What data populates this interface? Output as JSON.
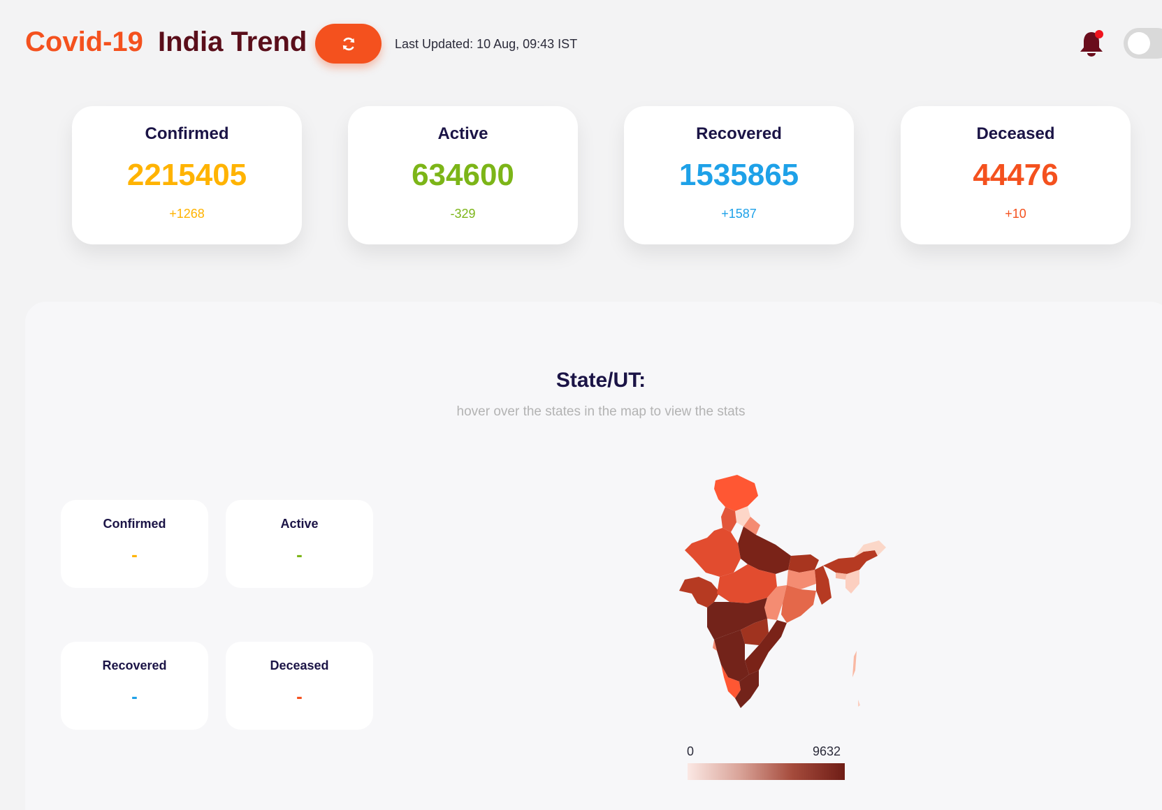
{
  "header": {
    "brand_primary": "Covid-19",
    "brand_secondary": "India Trend",
    "refresh_icon": "refresh-icon",
    "last_updated": "Last Updated: 10 Aug, 09:43 IST",
    "bell_icon": "bell-icon",
    "notification_dot": true,
    "theme_toggle": "off"
  },
  "stats": [
    {
      "label": "Confirmed",
      "value": "2215405",
      "delta": "+1268",
      "color": "#ffb300"
    },
    {
      "label": "Active",
      "value": "634600",
      "delta": "-329",
      "color": "#7cb518"
    },
    {
      "label": "Recovered",
      "value": "1535865",
      "delta": "+1587",
      "color": "#1ea1e8"
    },
    {
      "label": "Deceased",
      "value": "44476",
      "delta": "+10",
      "color": "#f4511e"
    }
  ],
  "state_panel": {
    "title": "State/UT:",
    "subtitle": "hover over the states in the map to view the stats",
    "cards": [
      {
        "label": "Confirmed",
        "value": "-",
        "color": "#ffb300"
      },
      {
        "label": "Active",
        "value": "-",
        "color": "#7cb518"
      },
      {
        "label": "Recovered",
        "value": "-",
        "color": "#1ea1e8"
      },
      {
        "label": "Deceased",
        "value": "-",
        "color": "#f4511e"
      }
    ]
  },
  "map": {
    "legend_min": "0",
    "legend_max": "9632",
    "colors": {
      "low": "#fbe8e4",
      "high": "#6f1d16",
      "accent": "#f4511e"
    }
  }
}
